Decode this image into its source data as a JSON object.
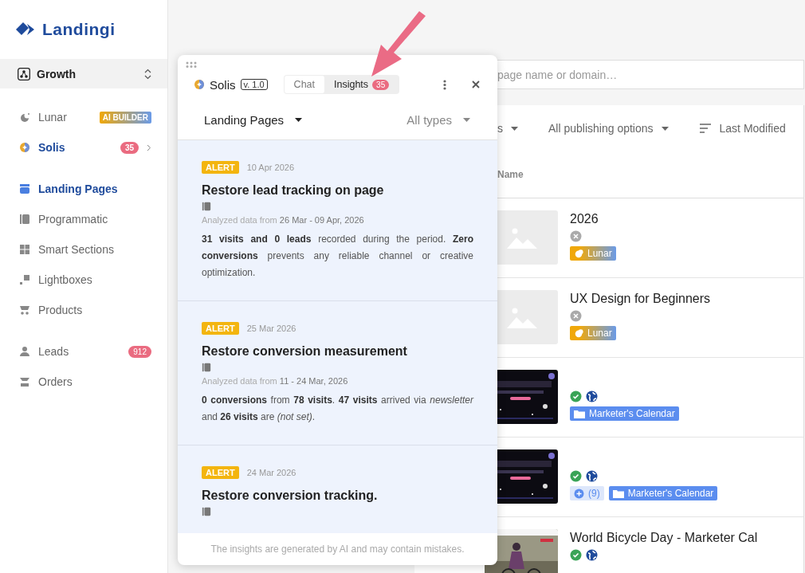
{
  "logo": {
    "text": "Landingi"
  },
  "workspace": {
    "name": "Growth"
  },
  "sidebar": {
    "groups": [
      {
        "items": [
          {
            "label": "Lunar",
            "selected": false,
            "badge": {
              "text": "AI BUILDER",
              "kind": "gradient"
            },
            "expandable": false
          },
          {
            "label": "Solis",
            "selected": true,
            "badge": {
              "text": "35",
              "kind": "count"
            },
            "expandable": true
          }
        ]
      },
      {
        "items": [
          {
            "label": "Landing Pages",
            "selected": true
          },
          {
            "label": "Programmatic",
            "selected": false
          },
          {
            "label": "Smart Sections",
            "selected": false
          },
          {
            "label": "Lightboxes",
            "selected": false
          },
          {
            "label": "Products",
            "selected": false
          }
        ]
      },
      {
        "items": [
          {
            "label": "Leads",
            "selected": false,
            "badge": {
              "text": "912",
              "kind": "count"
            }
          },
          {
            "label": "Orders",
            "selected": false
          }
        ]
      }
    ]
  },
  "search": {
    "placeholder": "page name or domain…"
  },
  "filters": [
    {
      "label": "s",
      "kind": "dropdown"
    },
    {
      "label": "All publishing options",
      "kind": "dropdown"
    },
    {
      "label": "Last Modified",
      "kind": "sort"
    }
  ],
  "table": {
    "columns": [
      "Name"
    ],
    "rows": [
      {
        "thumbnail": {
          "kind": "placeholder"
        },
        "title": "2026",
        "status": {
          "kind": "unpublished"
        },
        "tags": [
          {
            "kind": "lunar",
            "label": "Lunar"
          }
        ]
      },
      {
        "thumbnail": {
          "kind": "placeholder"
        },
        "title": "UX Design for Beginners",
        "status": {
          "kind": "unpublished"
        },
        "tags": [
          {
            "kind": "lunar",
            "label": "Lunar"
          }
        ]
      },
      {
        "thumbnail": {
          "kind": "picture"
        },
        "status": {
          "kind": "published"
        },
        "tags": [
          {
            "kind": "folder",
            "label": "Marketer's Calendar"
          }
        ]
      },
      {
        "thumbnail": {
          "kind": "picture"
        },
        "status": {
          "kind": "published"
        },
        "tags": [
          {
            "kind": "variants",
            "label": "(9)"
          },
          {
            "kind": "folder",
            "label": "Marketer's Calendar"
          }
        ]
      },
      {
        "thumbnail": {
          "kind": "picture"
        },
        "title": "World Bicycle Day - Marketer Cal",
        "status": {
          "kind": "published"
        }
      }
    ]
  },
  "panel": {
    "title": "Solis",
    "version": "v. 1.0",
    "tabs": [
      {
        "label": "Chat",
        "selected": false
      },
      {
        "label": "Insights",
        "selected": true,
        "badge": "35"
      }
    ],
    "scope": "Landing Pages",
    "type_filter": "All types",
    "insights": [
      {
        "tag": "ALERT",
        "date": "10 Apr 2026",
        "title": "Restore lead tracking on page",
        "analyzed": "Analyzed data from **26 Mar - 09 Apr, 2026**",
        "body": "**31 visits and 0 leads** recorded during the period. **Zero conversions** prevents any reliable channel or creative optimization."
      },
      {
        "tag": "ALERT",
        "date": "25 Mar 2026",
        "title": "Restore conversion measurement",
        "analyzed": "Analyzed data from **11 - 24 Mar, 2026**",
        "body": "**0 conversions** from **78 visits**. **47 visits** arrived via *newsletter* and **26 visits** are *(not set)*."
      },
      {
        "tag": "ALERT",
        "date": "24 Mar 2026",
        "title": "Restore conversion tracking."
      }
    ],
    "footer": "The insights are generated by AI and may contain mistakes."
  }
}
